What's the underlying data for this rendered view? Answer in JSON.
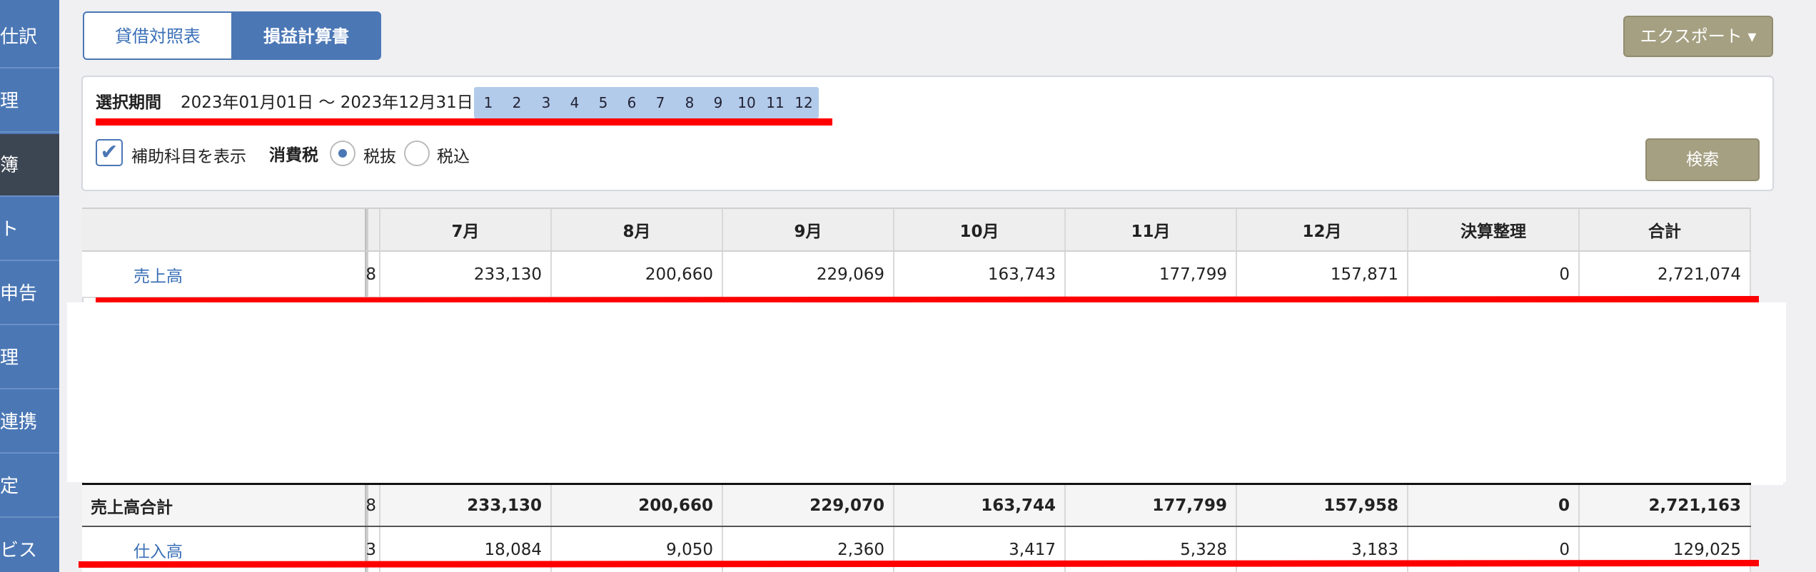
{
  "sidebar": {
    "items": [
      {
        "label": "仕訳",
        "active": false
      },
      {
        "label": "理",
        "active": false
      },
      {
        "label": "簿",
        "active": true
      },
      {
        "label": "ト",
        "active": false
      },
      {
        "label": "申告",
        "active": false
      },
      {
        "label": "理",
        "active": false
      },
      {
        "label": "連携",
        "active": false
      },
      {
        "label": "定",
        "active": false
      },
      {
        "label": "ビス",
        "active": false
      }
    ]
  },
  "tabs": {
    "balance_sheet": "貸借対照表",
    "income_statement": "損益計算書"
  },
  "export_button": "エクスポート ▾",
  "filter": {
    "period_label": "選択期間",
    "period_range": "2023年01月01日 〜 2023年12月31日",
    "months": [
      "1",
      "2",
      "3",
      "4",
      "5",
      "6",
      "7",
      "8",
      "9",
      "10",
      "11",
      "12"
    ],
    "show_sub_accounts_label": "補助科目を表示",
    "show_sub_accounts_checked": true,
    "tax_label": "消費税",
    "tax_excluded_label": "税抜",
    "tax_included_label": "税込",
    "tax_selected": "税抜",
    "search_button": "検索"
  },
  "table": {
    "headers": [
      "7月",
      "8月",
      "9月",
      "10月",
      "11月",
      "12月",
      "決算整理",
      "合計"
    ],
    "rows": {
      "sales": {
        "label": "売上高",
        "cut_value": "8",
        "values": [
          "233,130",
          "200,660",
          "229,069",
          "163,743",
          "177,799",
          "157,871",
          "0",
          "2,721,074"
        ]
      },
      "sales_total": {
        "label": "売上高合計",
        "cut_value": "8",
        "values": [
          "233,130",
          "200,660",
          "229,070",
          "163,744",
          "177,799",
          "157,958",
          "0",
          "2,721,163"
        ]
      },
      "purchases": {
        "label": "仕入高",
        "cut_value": "3",
        "values": [
          "18,084",
          "9,050",
          "2,360",
          "3,417",
          "5,328",
          "3,183",
          "0",
          "129,025"
        ]
      }
    }
  },
  "colors": {
    "sidebar_bg": "#4b77b5",
    "sidebar_active": "#3c4552",
    "accent": "#4b77b5",
    "link": "#3a6fb6",
    "button_olive": "#a5a082",
    "highlight_line": "#ff0000"
  }
}
